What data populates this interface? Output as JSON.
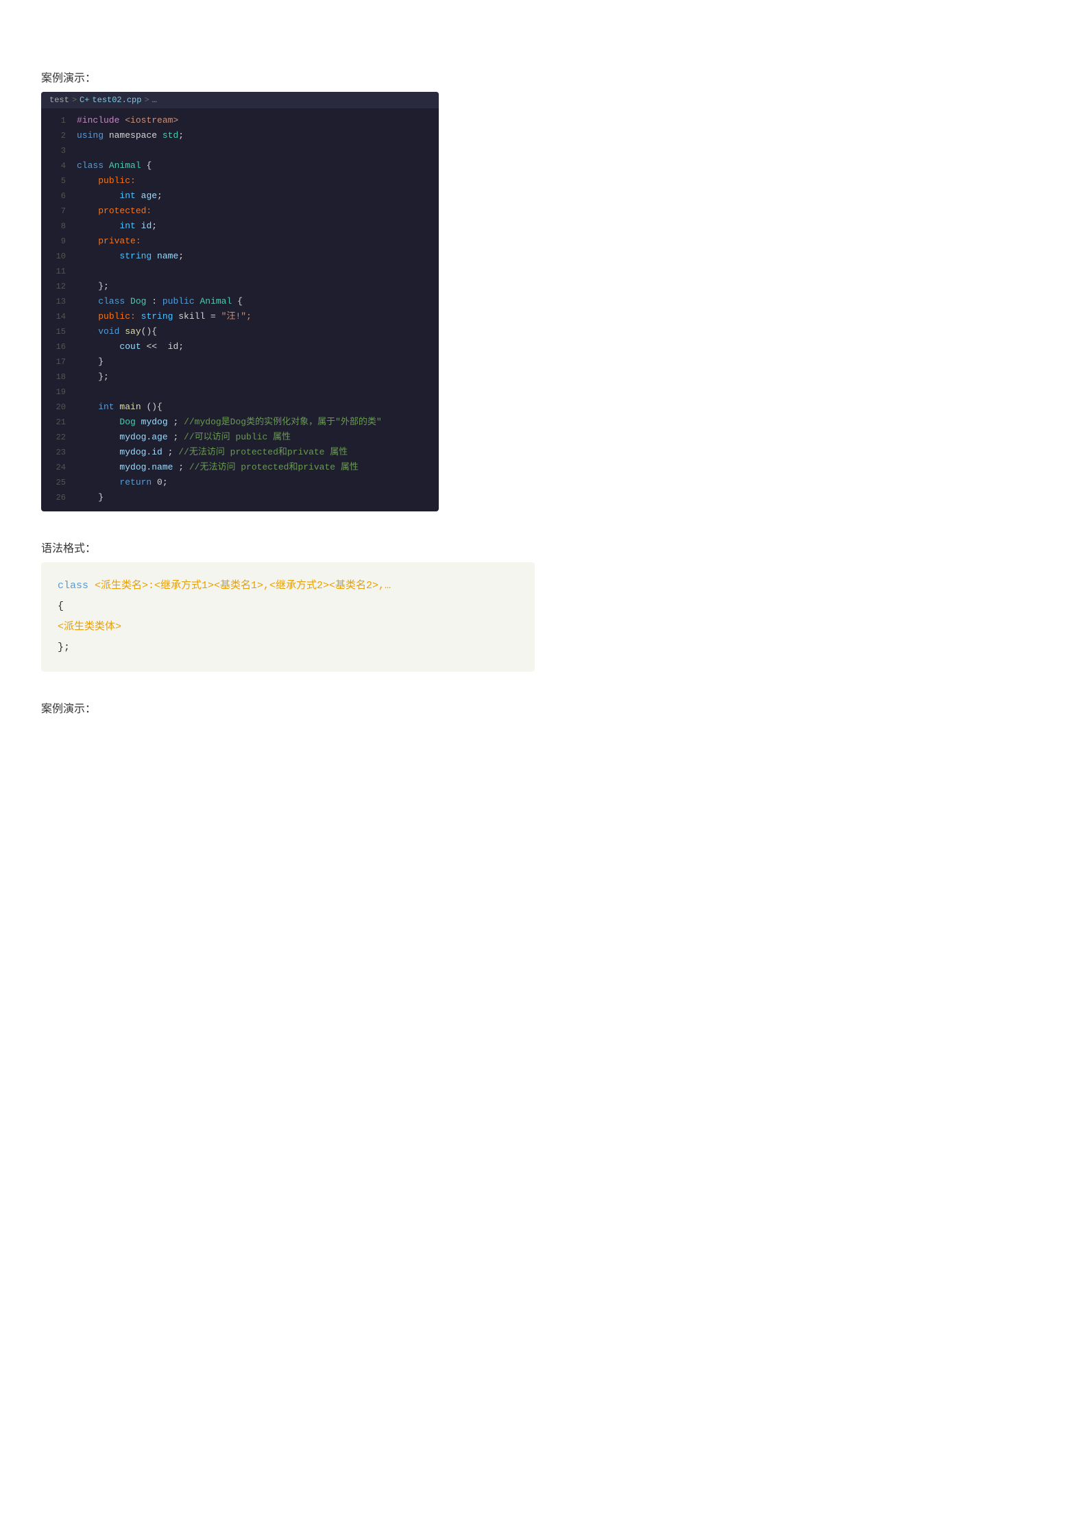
{
  "section1": {
    "label": "案例演示："
  },
  "breadcrumb": {
    "parts": [
      "test",
      ">",
      "C+",
      "test02.cpp",
      ">",
      "…"
    ]
  },
  "codeLines": [
    {
      "num": "1",
      "tokens": [
        {
          "t": "kw-purple",
          "v": "#include"
        },
        {
          "t": "plain",
          "v": " "
        },
        {
          "t": "kw-string",
          "v": "<iostream>"
        }
      ]
    },
    {
      "num": "2",
      "tokens": [
        {
          "t": "kw-blue",
          "v": "using"
        },
        {
          "t": "plain",
          "v": " namespace "
        },
        {
          "t": "kw-green",
          "v": "std"
        },
        {
          "t": "plain",
          "v": ";"
        }
      ]
    },
    {
      "num": "3",
      "tokens": []
    },
    {
      "num": "4",
      "tokens": [
        {
          "t": "kw-blue",
          "v": "class"
        },
        {
          "t": "plain",
          "v": " "
        },
        {
          "t": "kw-green",
          "v": "Animal"
        },
        {
          "t": "plain",
          "v": " {"
        }
      ]
    },
    {
      "num": "5",
      "tokens": [
        {
          "t": "plain",
          "v": "    "
        },
        {
          "t": "kw-orange",
          "v": "public:"
        }
      ]
    },
    {
      "num": "6",
      "tokens": [
        {
          "t": "plain",
          "v": "        "
        },
        {
          "t": "kw-int",
          "v": "int"
        },
        {
          "t": "plain",
          "v": " "
        },
        {
          "t": "kw-cyan",
          "v": "age"
        },
        {
          "t": "plain",
          "v": ";"
        }
      ]
    },
    {
      "num": "7",
      "tokens": [
        {
          "t": "plain",
          "v": "    "
        },
        {
          "t": "kw-orange",
          "v": "protected:"
        }
      ]
    },
    {
      "num": "8",
      "tokens": [
        {
          "t": "plain",
          "v": "        "
        },
        {
          "t": "kw-int",
          "v": "int"
        },
        {
          "t": "plain",
          "v": " "
        },
        {
          "t": "kw-cyan",
          "v": "id"
        },
        {
          "t": "plain",
          "v": ";"
        }
      ]
    },
    {
      "num": "9",
      "tokens": [
        {
          "t": "plain",
          "v": "    "
        },
        {
          "t": "kw-orange",
          "v": "private:"
        }
      ]
    },
    {
      "num": "10",
      "tokens": [
        {
          "t": "plain",
          "v": "        "
        },
        {
          "t": "kw-int",
          "v": "string"
        },
        {
          "t": "plain",
          "v": " "
        },
        {
          "t": "kw-cyan",
          "v": "name"
        },
        {
          "t": "plain",
          "v": ";"
        }
      ]
    },
    {
      "num": "11",
      "tokens": []
    },
    {
      "num": "12",
      "tokens": [
        {
          "t": "plain",
          "v": "    "
        },
        {
          "t": "plain",
          "v": "};"
        }
      ]
    },
    {
      "num": "13",
      "tokens": [
        {
          "t": "kw-blue",
          "v": "    class"
        },
        {
          "t": "plain",
          "v": " "
        },
        {
          "t": "kw-green",
          "v": "Dog"
        },
        {
          "t": "plain",
          "v": " : "
        },
        {
          "t": "kw-blue",
          "v": "public"
        },
        {
          "t": "plain",
          "v": " "
        },
        {
          "t": "kw-green",
          "v": "Animal"
        },
        {
          "t": "plain",
          "v": " {"
        }
      ]
    },
    {
      "num": "14",
      "tokens": [
        {
          "t": "plain",
          "v": "    "
        },
        {
          "t": "kw-orange",
          "v": "public:"
        },
        {
          "t": "plain",
          "v": " "
        },
        {
          "t": "kw-int",
          "v": "string"
        },
        {
          "t": "plain",
          "v": " skill = "
        },
        {
          "t": "kw-string",
          "v": "\"汪!\";"
        }
      ]
    },
    {
      "num": "15",
      "tokens": [
        {
          "t": "plain",
          "v": "    "
        },
        {
          "t": "kw-blue",
          "v": "void"
        },
        {
          "t": "plain",
          "v": " "
        },
        {
          "t": "kw-yellow",
          "v": "say"
        },
        {
          "t": "plain",
          "v": "(){"
        }
      ]
    },
    {
      "num": "16",
      "tokens": [
        {
          "t": "plain",
          "v": "        "
        },
        {
          "t": "kw-cyan",
          "v": "cout"
        },
        {
          "t": "plain",
          "v": " << "
        },
        {
          "t": "plain",
          "v": " id;"
        }
      ]
    },
    {
      "num": "17",
      "tokens": [
        {
          "t": "plain",
          "v": "    }"
        }
      ]
    },
    {
      "num": "18",
      "tokens": [
        {
          "t": "plain",
          "v": "    "
        },
        {
          "t": "plain",
          "v": "};"
        }
      ]
    },
    {
      "num": "19",
      "tokens": []
    },
    {
      "num": "20",
      "tokens": [
        {
          "t": "kw-blue",
          "v": "    int"
        },
        {
          "t": "plain",
          "v": " "
        },
        {
          "t": "kw-yellow",
          "v": "main"
        },
        {
          "t": "plain",
          "v": " (){"
        }
      ]
    },
    {
      "num": "21",
      "tokens": [
        {
          "t": "plain",
          "v": "        "
        },
        {
          "t": "kw-green",
          "v": "Dog"
        },
        {
          "t": "plain",
          "v": " "
        },
        {
          "t": "kw-cyan",
          "v": "mydog"
        },
        {
          "t": "plain",
          "v": " ; "
        },
        {
          "t": "kw-comment",
          "v": "//mydog是Dog类的实例化对象，属于\"外部的类\""
        }
      ]
    },
    {
      "num": "22",
      "tokens": [
        {
          "t": "plain",
          "v": "        "
        },
        {
          "t": "kw-cyan",
          "v": "mydog.age"
        },
        {
          "t": "plain",
          "v": " ; "
        },
        {
          "t": "kw-comment",
          "v": "//可以访问 public 属性"
        }
      ]
    },
    {
      "num": "23",
      "tokens": [
        {
          "t": "plain",
          "v": "        "
        },
        {
          "t": "kw-cyan",
          "v": "mydog.id"
        },
        {
          "t": "plain",
          "v": " ; "
        },
        {
          "t": "kw-comment",
          "v": "//无法访问 protected和private 属性"
        }
      ]
    },
    {
      "num": "24",
      "tokens": [
        {
          "t": "plain",
          "v": "        "
        },
        {
          "t": "kw-cyan",
          "v": "mydog.name"
        },
        {
          "t": "plain",
          "v": " ; "
        },
        {
          "t": "kw-comment",
          "v": "//无法访问 protected和private 属性"
        }
      ]
    },
    {
      "num": "25",
      "tokens": [
        {
          "t": "plain",
          "v": "        "
        },
        {
          "t": "kw-blue",
          "v": "return"
        },
        {
          "t": "plain",
          "v": " "
        },
        {
          "t": "plain",
          "v": "0;"
        }
      ]
    },
    {
      "num": "26",
      "tokens": [
        {
          "t": "plain",
          "v": "    }"
        }
      ]
    }
  ],
  "section2": {
    "label": "语法格式："
  },
  "syntaxBlock": {
    "line1": "class <派生类名>:<继承方式1><基类名1>,<继承方式2><基类名2>,...",
    "line2": "{",
    "line3": "<派生类类体>",
    "line4": "};"
  },
  "section3": {
    "label": "案例演示："
  }
}
